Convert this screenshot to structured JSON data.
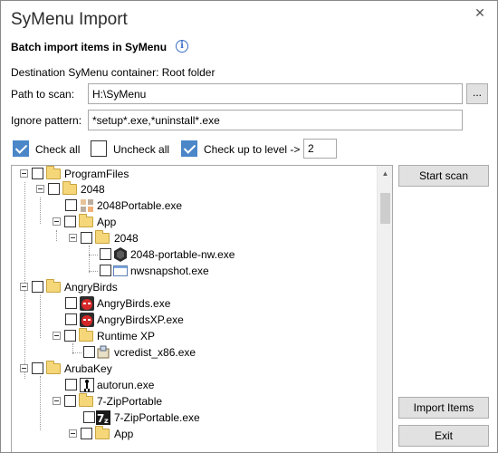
{
  "window": {
    "title": "SyMenu Import",
    "close_icon": "close-icon"
  },
  "header": {
    "subtitle": "Batch import items in SyMenu",
    "info_icon": "info-icon"
  },
  "destination": "Destination SyMenu container: Root folder",
  "path": {
    "label": "Path to scan:",
    "value": "H:\\SyMenu",
    "browse_label": "..."
  },
  "ignore": {
    "label": "Ignore pattern:",
    "value": "*setup*.exe,*uninstall*.exe"
  },
  "options": {
    "check_all": "Check all",
    "uncheck_all": "Uncheck all",
    "check_up_to_level": "Check up to level ->",
    "level_value": "2"
  },
  "buttons": {
    "start_scan": "Start scan",
    "import_items": "Import Items",
    "exit": "Exit"
  },
  "tree": [
    {
      "label": "ProgramFiles",
      "icon": "folder-icon"
    },
    {
      "label": "2048",
      "icon": "folder-icon"
    },
    {
      "label": "2048Portable.exe",
      "icon": "2048-app-icon"
    },
    {
      "label": "App",
      "icon": "folder-icon"
    },
    {
      "label": "2048",
      "icon": "folder-icon"
    },
    {
      "label": "2048-portable-nw.exe",
      "icon": "nw-app-icon"
    },
    {
      "label": "nwsnapshot.exe",
      "icon": "window-app-icon"
    },
    {
      "label": "AngryBirds",
      "icon": "folder-icon"
    },
    {
      "label": "AngryBirds.exe",
      "icon": "angry-birds-icon"
    },
    {
      "label": "AngryBirdsXP.exe",
      "icon": "angry-birds-icon"
    },
    {
      "label": "Runtime XP",
      "icon": "folder-icon"
    },
    {
      "label": "vcredist_x86.exe",
      "icon": "installer-icon"
    },
    {
      "label": "ArubaKey",
      "icon": "folder-icon"
    },
    {
      "label": "autorun.exe",
      "icon": "autorun-icon"
    },
    {
      "label": "7-ZipPortable",
      "icon": "folder-icon"
    },
    {
      "label": "7-ZipPortable.exe",
      "icon": "7zip-icon"
    },
    {
      "label": "App",
      "icon": "folder-icon"
    }
  ]
}
